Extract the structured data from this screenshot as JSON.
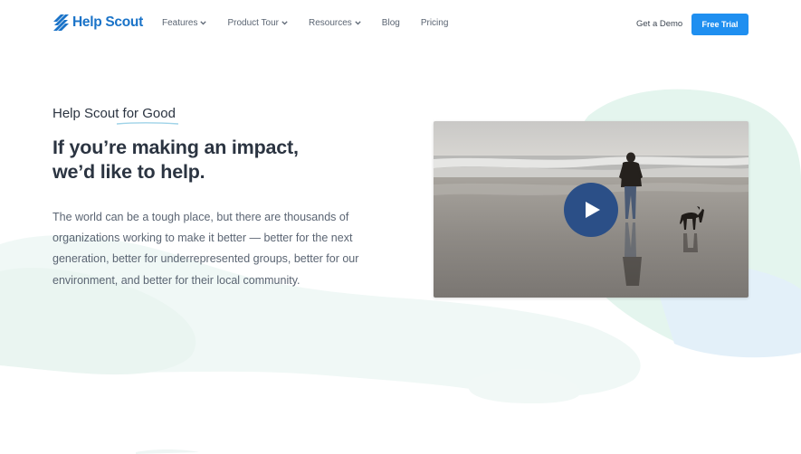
{
  "header": {
    "logo_text": "Help Scout",
    "nav": [
      {
        "label": "Features",
        "dropdown": true
      },
      {
        "label": "Product Tour",
        "dropdown": true
      },
      {
        "label": "Resources",
        "dropdown": true
      },
      {
        "label": "Blog",
        "dropdown": false
      },
      {
        "label": "Pricing",
        "dropdown": false
      }
    ],
    "get_demo": "Get a Demo",
    "free_trial": "Free Trial"
  },
  "hero": {
    "eyebrow": "Help Scout for Good",
    "headline_line1": "If you’re making an impact,",
    "headline_line2": "we’d like to help.",
    "body": "The world can be a tough place, but there are thousands of organizations working to make it better — better for the next generation, better for underrepresented groups, better for our environment, and better for their local community."
  },
  "video": {
    "icons": [
      "play-icon"
    ]
  },
  "colors": {
    "brand": "#1a73c8",
    "button": "#1f8ff0",
    "text_dark": "#2b3441",
    "text_muted": "#5b6573",
    "play_button": "#2b4f87",
    "blob_green": "#dff3ec",
    "blob_blue": "#e6f2fa"
  }
}
